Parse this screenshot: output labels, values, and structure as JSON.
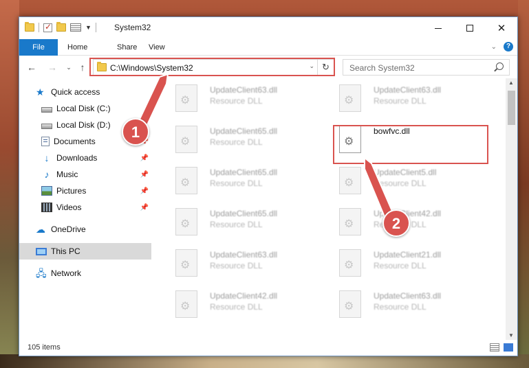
{
  "window": {
    "title": "System32"
  },
  "ribbon": {
    "tabs": [
      "File",
      "Home",
      "Share",
      "View"
    ]
  },
  "navigation": {
    "address": "C:\\Windows\\System32",
    "search_placeholder": "Search System32"
  },
  "sidebar": {
    "items": [
      {
        "label": "Quick access",
        "icon": "star-icon"
      },
      {
        "label": "Local Disk (C:)",
        "icon": "disk-icon"
      },
      {
        "label": "Local Disk (D:)",
        "icon": "disk-icon"
      },
      {
        "label": "Documents",
        "icon": "documents-icon",
        "pinned": true
      },
      {
        "label": "Downloads",
        "icon": "download-icon",
        "pinned": true
      },
      {
        "label": "Music",
        "icon": "music-icon",
        "pinned": true
      },
      {
        "label": "Pictures",
        "icon": "pictures-icon",
        "pinned": true
      },
      {
        "label": "Videos",
        "icon": "videos-icon",
        "pinned": true
      },
      {
        "label": "OneDrive",
        "icon": "cloud-icon"
      },
      {
        "label": "This PC",
        "icon": "pc-icon",
        "selected": true
      },
      {
        "label": "Network",
        "icon": "network-icon"
      }
    ]
  },
  "files": {
    "left_column": [
      {
        "name": "UpdateClient63.dll",
        "type": "Resource DLL"
      },
      {
        "name": "UpdateClient65.dll",
        "type": "Resource DLL"
      },
      {
        "name": "UpdateClient65.dll",
        "type": "Resource DLL"
      },
      {
        "name": "UpdateClient65.dll",
        "type": "Resource DLL"
      },
      {
        "name": "UpdateClient63.dll",
        "type": "Resource DLL"
      },
      {
        "name": "UpdateClient42.dll",
        "type": "Resource DLL"
      }
    ],
    "right_column": [
      {
        "name": "UpdateClient63.dll",
        "type": "Resource DLL"
      },
      {
        "name": "bowfvc.dll",
        "type": ""
      },
      {
        "name": "UpdateClient5.dll",
        "type": "Resource DLL"
      },
      {
        "name": "UpdateClient42.dll",
        "type": "Resource DLL"
      },
      {
        "name": "UpdateClient21.dll",
        "type": "Resource DLL"
      },
      {
        "name": "UpdateClient63.dll",
        "type": "Resource DLL"
      }
    ]
  },
  "status": {
    "item_count": "105 items"
  },
  "annotations": {
    "step1": "1",
    "step2": "2"
  },
  "colors": {
    "accent": "#1979ca",
    "highlight": "#d9534f"
  }
}
